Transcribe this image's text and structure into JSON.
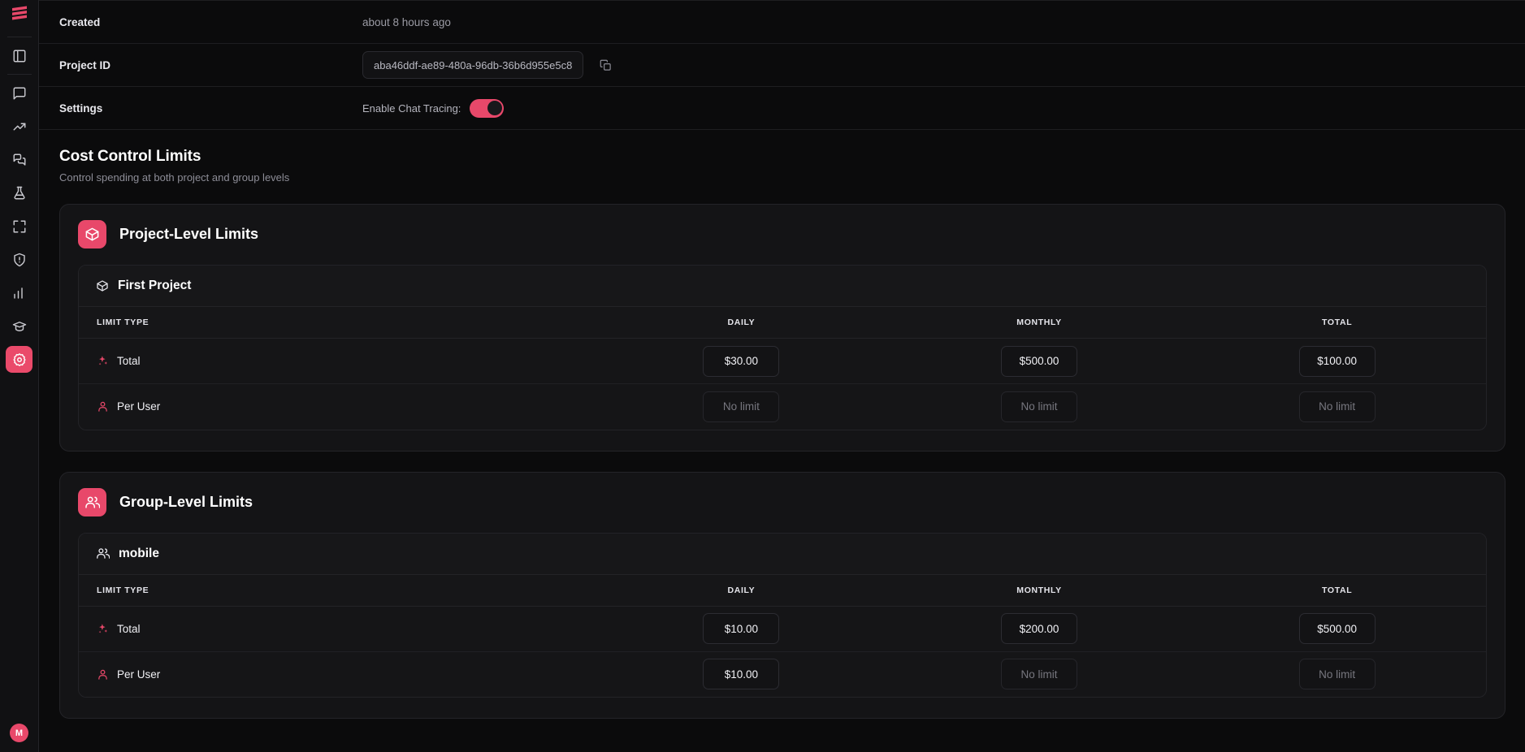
{
  "sidebar": {
    "logo": "logo-stripes",
    "items": [
      {
        "icon": "panel-left-icon",
        "name": "sidebar-item-panel",
        "active": false
      },
      {
        "icon": "message-square-icon",
        "name": "sidebar-item-chat",
        "active": false
      },
      {
        "icon": "trending-up-icon",
        "name": "sidebar-item-analytics",
        "active": false
      },
      {
        "icon": "messages-icon",
        "name": "sidebar-item-conversations",
        "active": false
      },
      {
        "icon": "flask-icon",
        "name": "sidebar-item-experiments",
        "active": false
      },
      {
        "icon": "maximize-icon",
        "name": "sidebar-item-expand",
        "active": false
      },
      {
        "icon": "shield-alert-icon",
        "name": "sidebar-item-guardrails",
        "active": false
      },
      {
        "icon": "bar-chart-icon",
        "name": "sidebar-item-reports",
        "active": false
      },
      {
        "icon": "graduation-cap-icon",
        "name": "sidebar-item-learn",
        "active": false
      },
      {
        "icon": "gear-icon",
        "name": "sidebar-item-settings",
        "active": true
      }
    ],
    "avatar_initial": "M"
  },
  "accent_color": "#e8486a",
  "info": {
    "rows": [
      {
        "label": "Created",
        "value": "about 8 hours ago",
        "type": "text"
      },
      {
        "label": "Project ID",
        "value": "aba46ddf-ae89-480a-96db-36b6d955e5c8",
        "type": "id"
      },
      {
        "label": "Settings",
        "toggle_label": "Enable Chat Tracing:",
        "toggle_on": true,
        "type": "settings"
      }
    ]
  },
  "section": {
    "title": "Cost Control Limits",
    "subtitle": "Control spending at both project and group levels"
  },
  "cards": [
    {
      "title": "Project-Level Limits",
      "icon": "package-icon",
      "panel": {
        "title": "First Project",
        "icon": "package-icon",
        "columns": [
          "LIMIT TYPE",
          "DAILY",
          "MONTHLY",
          "TOTAL"
        ],
        "rows": [
          {
            "type": "Total",
            "icon": "sparkles-icon",
            "daily": "$30.00",
            "monthly": "$500.00",
            "total": "$100.00",
            "daily_empty": false,
            "monthly_empty": false,
            "total_empty": false
          },
          {
            "type": "Per User",
            "icon": "user-icon",
            "daily": "No limit",
            "monthly": "No limit",
            "total": "No limit",
            "daily_empty": true,
            "monthly_empty": true,
            "total_empty": true
          }
        ]
      }
    },
    {
      "title": "Group-Level Limits",
      "icon": "users-icon",
      "panel": {
        "title": "mobile",
        "icon": "users-icon",
        "columns": [
          "LIMIT TYPE",
          "DAILY",
          "MONTHLY",
          "TOTAL"
        ],
        "rows": [
          {
            "type": "Total",
            "icon": "sparkles-icon",
            "daily": "$10.00",
            "monthly": "$200.00",
            "total": "$500.00",
            "daily_empty": false,
            "monthly_empty": false,
            "total_empty": false
          },
          {
            "type": "Per User",
            "icon": "user-icon",
            "daily": "$10.00",
            "monthly": "No limit",
            "total": "No limit",
            "daily_empty": false,
            "monthly_empty": true,
            "total_empty": true
          }
        ]
      }
    }
  ]
}
